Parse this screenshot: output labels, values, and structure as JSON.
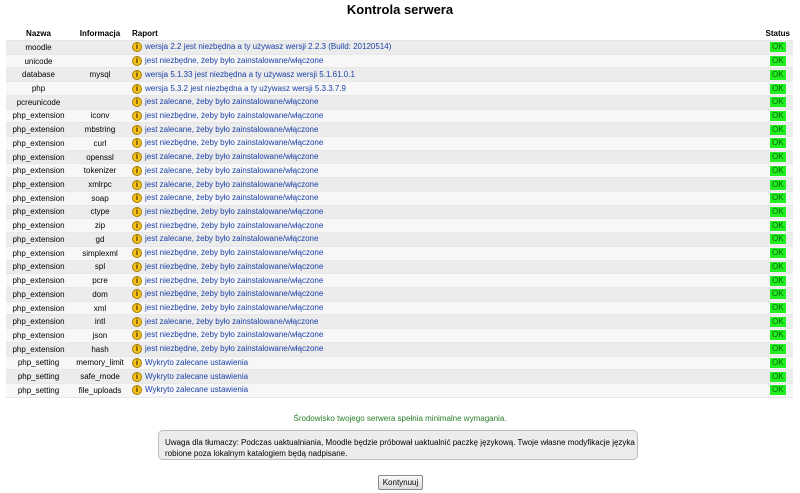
{
  "title": "Kontrola serwera",
  "columns": {
    "name": "Nazwa",
    "info": "Informacja",
    "report": "Raport",
    "status": "Status"
  },
  "rows": [
    {
      "name": "moodle",
      "info": "",
      "report": "wersja 2.2 jest niezbędna a ty używasz wersji 2.2.3 (Build: 20120514)",
      "status": "OK"
    },
    {
      "name": "unicode",
      "info": "",
      "report": "jest niezbędne, żeby było zainstalowane/włączone",
      "status": "OK"
    },
    {
      "name": "database",
      "info": "mysql",
      "report": "wersja 5.1.33 jest niezbędna a ty używasz wersji 5.1.61.0.1",
      "status": "OK"
    },
    {
      "name": "php",
      "info": "",
      "report": "wersja 5.3.2 jest niezbędna a ty używasz wersji 5.3.3.7.9",
      "status": "OK"
    },
    {
      "name": "pcreunicode",
      "info": "",
      "report": "jest zalecane, żeby było zainstalowane/włączone",
      "status": "OK"
    },
    {
      "name": "php_extension",
      "info": "iconv",
      "report": "jest niezbędne, żeby było zainstalowane/włączone",
      "status": "OK"
    },
    {
      "name": "php_extension",
      "info": "mbstring",
      "report": "jest zalecane, żeby było zainstalowane/włączone",
      "status": "OK"
    },
    {
      "name": "php_extension",
      "info": "curl",
      "report": "jest niezbędne, żeby było zainstalowane/włączone",
      "status": "OK"
    },
    {
      "name": "php_extension",
      "info": "openssl",
      "report": "jest zalecane, żeby było zainstalowane/włączone",
      "status": "OK"
    },
    {
      "name": "php_extension",
      "info": "tokenizer",
      "report": "jest zalecane, żeby było zainstalowane/włączone",
      "status": "OK"
    },
    {
      "name": "php_extension",
      "info": "xmlrpc",
      "report": "jest zalecane, żeby było zainstalowane/włączone",
      "status": "OK"
    },
    {
      "name": "php_extension",
      "info": "soap",
      "report": "jest zalecane, żeby było zainstalowane/włączone",
      "status": "OK"
    },
    {
      "name": "php_extension",
      "info": "ctype",
      "report": "jest niezbędne, żeby było zainstalowane/włączone",
      "status": "OK"
    },
    {
      "name": "php_extension",
      "info": "zip",
      "report": "jest niezbędne, żeby było zainstalowane/włączone",
      "status": "OK"
    },
    {
      "name": "php_extension",
      "info": "gd",
      "report": "jest zalecane, żeby było zainstalowane/włączone",
      "status": "OK"
    },
    {
      "name": "php_extension",
      "info": "simplexml",
      "report": "jest niezbędne, żeby było zainstalowane/włączone",
      "status": "OK"
    },
    {
      "name": "php_extension",
      "info": "spl",
      "report": "jest niezbędne, żeby było zainstalowane/włączone",
      "status": "OK"
    },
    {
      "name": "php_extension",
      "info": "pcre",
      "report": "jest niezbędne, żeby było zainstalowane/włączone",
      "status": "OK"
    },
    {
      "name": "php_extension",
      "info": "dom",
      "report": "jest niezbędne, żeby było zainstalowane/włączone",
      "status": "OK"
    },
    {
      "name": "php_extension",
      "info": "xml",
      "report": "jest niezbędne, żeby było zainstalowane/włączone",
      "status": "OK"
    },
    {
      "name": "php_extension",
      "info": "intl",
      "report": "jest zalecane, żeby było zainstalowane/włączone",
      "status": "OK"
    },
    {
      "name": "php_extension",
      "info": "json",
      "report": "jest niezbędne, żeby było zainstalowane/włączone",
      "status": "OK"
    },
    {
      "name": "php_extension",
      "info": "hash",
      "report": "jest niezbędne, żeby było zainstalowane/włączone",
      "status": "OK"
    },
    {
      "name": "php_setting",
      "info": "memory_limit",
      "report": "Wykryto zalecane ustawienia",
      "status": "OK"
    },
    {
      "name": "php_setting",
      "info": "safe_mode",
      "report": "Wykryto zalecane ustawienia",
      "status": "OK"
    },
    {
      "name": "php_setting",
      "info": "file_uploads",
      "report": "Wykryto zalecane ustawienia",
      "status": "OK"
    }
  ],
  "summary": "Środowisko twojego serwera spełnia minimalne wymagania.",
  "notice": "Uwaga dla tłumaczy: Podczas uaktualniania, Moodle będzie próbował uaktualnić paczkę językową. Twoje własne modyfikacje języka robione poza lokalnym katalogiem będą nadpisane.",
  "continue_label": "Kontynuuj",
  "icons": {
    "report_row": "info-warning-icon"
  },
  "colors": {
    "status_ok_bg": "#22ee22",
    "status_ok_text": "#006600",
    "report_text": "#1a3fa8",
    "summary_text": "#2a7d2a"
  }
}
